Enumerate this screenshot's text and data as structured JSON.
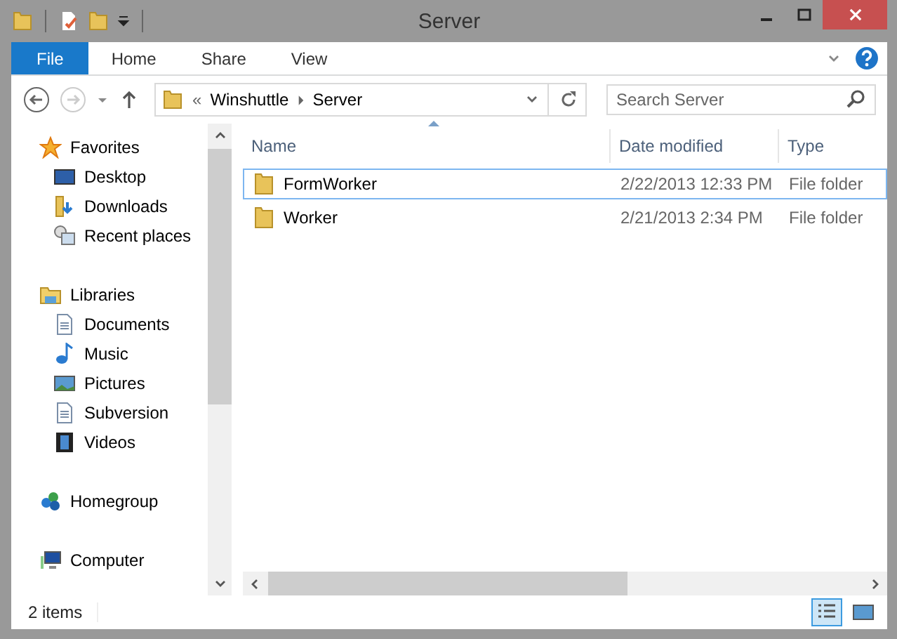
{
  "window": {
    "title": "Server"
  },
  "ribbon": {
    "tabs": [
      {
        "label": "File",
        "selected": true
      },
      {
        "label": "Home",
        "selected": false
      },
      {
        "label": "Share",
        "selected": false
      },
      {
        "label": "View",
        "selected": false
      }
    ]
  },
  "address": {
    "overflow": "«",
    "path": [
      "Winshuttle",
      "Server"
    ]
  },
  "search": {
    "placeholder": "Search Server"
  },
  "sidebar": {
    "groups": [
      {
        "label": "Favorites",
        "kind": "star",
        "children": [
          {
            "label": "Desktop",
            "kind": "desktop"
          },
          {
            "label": "Downloads",
            "kind": "download"
          },
          {
            "label": "Recent places",
            "kind": "recent"
          }
        ]
      },
      {
        "label": "Libraries",
        "kind": "library",
        "children": [
          {
            "label": "Documents",
            "kind": "document"
          },
          {
            "label": "Music",
            "kind": "music"
          },
          {
            "label": "Pictures",
            "kind": "picture"
          },
          {
            "label": "Subversion",
            "kind": "document"
          },
          {
            "label": "Videos",
            "kind": "video"
          }
        ]
      },
      {
        "label": "Homegroup",
        "kind": "homegroup"
      },
      {
        "label": "Computer",
        "kind": "computer"
      }
    ]
  },
  "table": {
    "columns": [
      "Name",
      "Date modified",
      "Type"
    ],
    "rows": [
      {
        "name": "FormWorker",
        "date": "2/22/2013 12:33 PM",
        "type": "File folder",
        "selected": true
      },
      {
        "name": "Worker",
        "date": "2/21/2013 2:34 PM",
        "type": "File folder",
        "selected": false
      }
    ]
  },
  "status_bar": {
    "text": "2 items"
  }
}
